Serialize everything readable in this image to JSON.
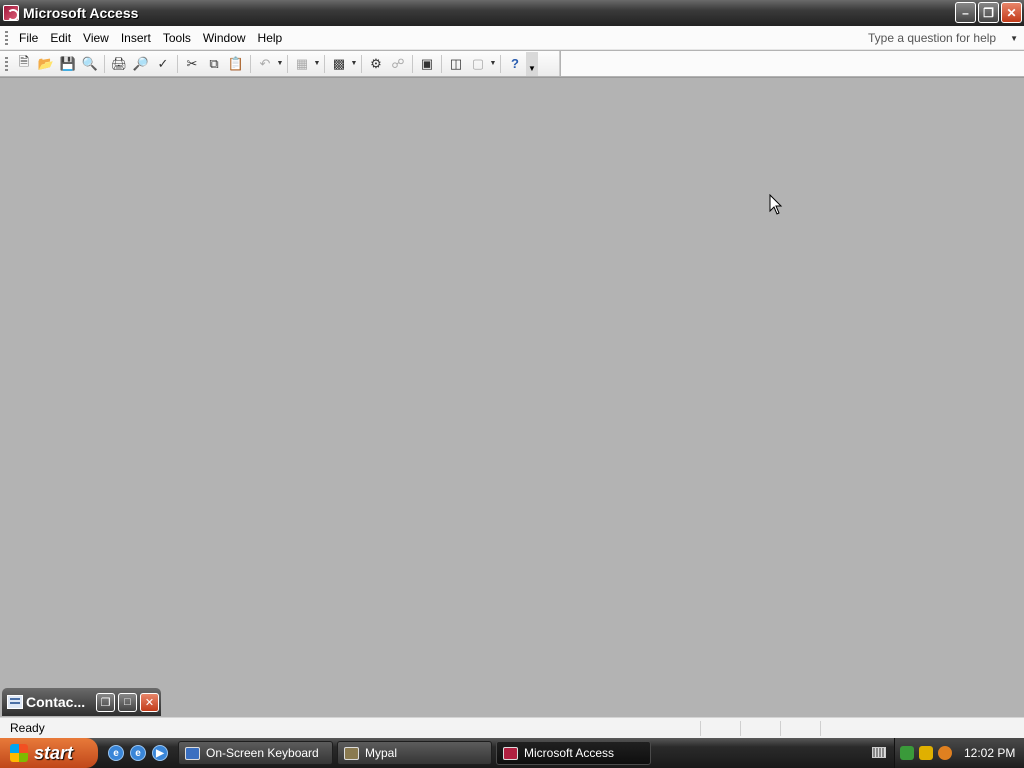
{
  "window": {
    "title": "Microsoft Access"
  },
  "menu": {
    "items": [
      {
        "label": "File"
      },
      {
        "label": "Edit"
      },
      {
        "label": "View"
      },
      {
        "label": "Insert"
      },
      {
        "label": "Tools"
      },
      {
        "label": "Window"
      },
      {
        "label": "Help"
      }
    ],
    "help_placeholder": "Type a question for help"
  },
  "child_window": {
    "title": "Contac..."
  },
  "status": {
    "text": "Ready"
  },
  "taskbar": {
    "start_label": "start",
    "tasks": [
      {
        "label": "On-Screen Keyboard"
      },
      {
        "label": "Mypal"
      },
      {
        "label": "Microsoft Access"
      }
    ],
    "clock": "12:02 PM"
  }
}
